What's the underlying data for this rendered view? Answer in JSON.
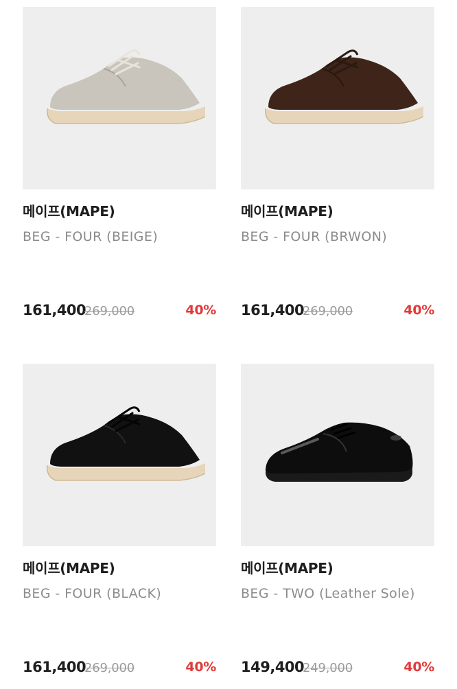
{
  "products": [
    {
      "brand": "메이프(MAPE)",
      "name": "BEG - FOUR (BEIGE)",
      "price": "161,400",
      "original_price": "269,000",
      "discount": "40%",
      "image_icon": "beige-suede-derby-shoe",
      "upper_color": "#c9c5bc",
      "sole_color": "#e6d5b8"
    },
    {
      "brand": "메이프(MAPE)",
      "name": "BEG - FOUR (BRWON)",
      "price": "161,400",
      "original_price": "269,000",
      "discount": "40%",
      "image_icon": "brown-suede-derby-shoe",
      "upper_color": "#3e2419",
      "sole_color": "#e6d5b8"
    },
    {
      "brand": "메이프(MAPE)",
      "name": "BEG - FOUR (BLACK)",
      "price": "161,400",
      "original_price": "269,000",
      "discount": "40%",
      "image_icon": "black-suede-derby-shoe",
      "upper_color": "#111111",
      "sole_color": "#e6d5b8"
    },
    {
      "brand": "메이프(MAPE)",
      "name": "BEG - TWO (Leather Sole)",
      "price": "149,400",
      "original_price": "249,000",
      "discount": "40%",
      "image_icon": "black-leather-derby-shoe",
      "upper_color": "#0d0d0d",
      "sole_color": "#1a1a1a"
    }
  ],
  "colors": {
    "discount": "#e03a3a",
    "price": "#1e1e1e",
    "name": "#8c8c8c",
    "image_bg": "#eeeeee"
  }
}
